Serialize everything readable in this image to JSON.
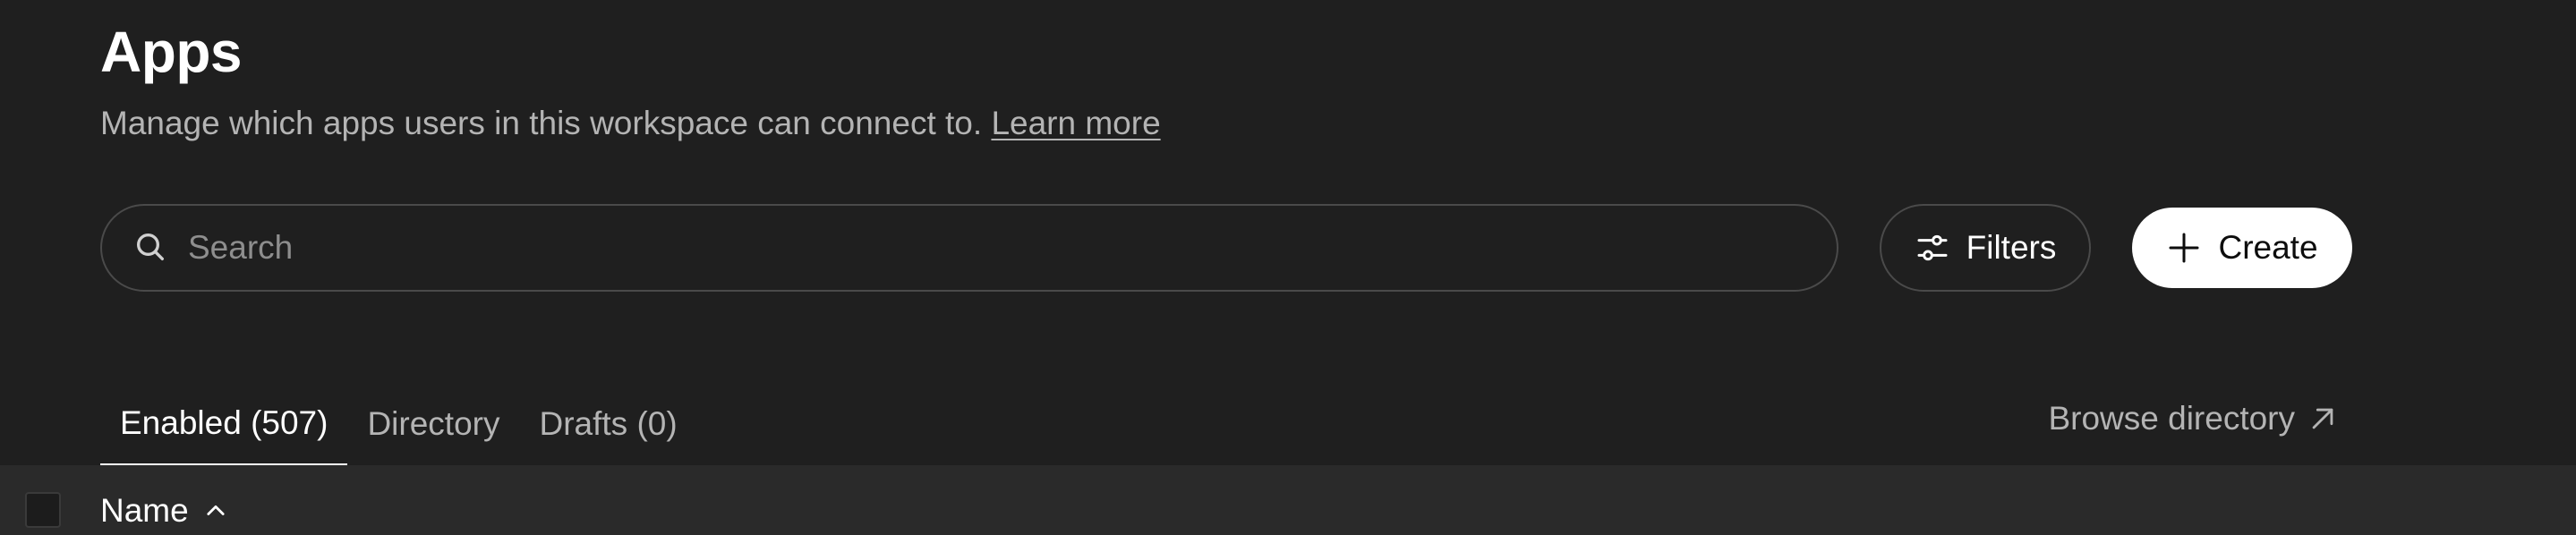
{
  "header": {
    "title": "Apps",
    "subtitle": "Manage which apps users in this workspace can connect to.",
    "learn_more": "Learn more"
  },
  "search": {
    "placeholder": "Search",
    "value": ""
  },
  "toolbar": {
    "filters_label": "Filters",
    "create_label": "Create"
  },
  "tabs": [
    {
      "label": "Enabled (507)",
      "active": true
    },
    {
      "label": "Directory",
      "active": false
    },
    {
      "label": "Drafts (0)",
      "active": false
    }
  ],
  "browse_directory": "Browse directory",
  "table": {
    "columns": [
      {
        "label": "Name",
        "sort": "ascending"
      }
    ]
  },
  "icons": {
    "search": "search-icon",
    "filters": "sliders-icon",
    "create": "plus-icon",
    "browse": "arrow-up-right-icon",
    "sort": "chevron-up-icon"
  },
  "colors": {
    "background": "#1f1f1f",
    "table_header_bg": "#2a2a2a",
    "primary_button_bg": "#ffffff",
    "muted_text": "#b4b4b4"
  }
}
